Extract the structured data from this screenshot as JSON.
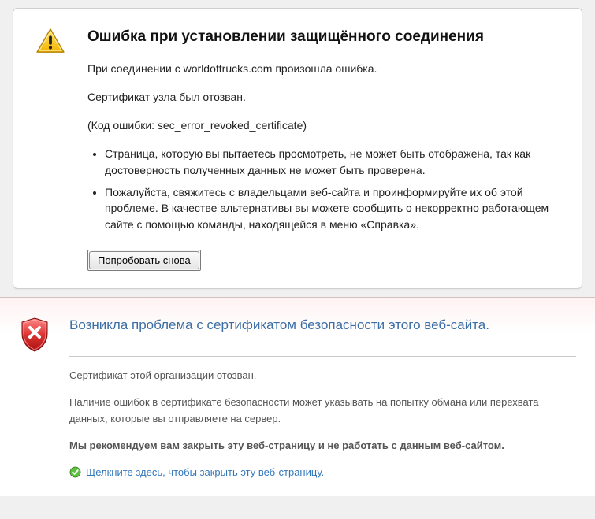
{
  "firefox": {
    "title": "Ошибка при установлении защищённого соединения",
    "p1": "При соединении с worldoftrucks.com произошла ошибка.",
    "p2": "Сертификат узла был отозван.",
    "p3": "(Код ошибки: sec_error_revoked_certificate)",
    "bullet1": "Страница, которую вы пытаетесь просмотреть, не может быть отображена, так как достоверность полученных данных не может быть проверена.",
    "bullet2": "Пожалуйста, свяжитесь с владельцами веб-сайта и проинформируйте их об этой проблеме. В качестве альтернативы вы можете сообщить о некорректно работающем сайте с помощью команды, находящейся в меню «Справка».",
    "retry_label": "Попробовать снова"
  },
  "ie": {
    "title": "Возникла проблема с сертификатом безопасности этого веб-сайта.",
    "revoked": "Сертификат этой организации отозван.",
    "warning": "Наличие ошибок в сертификате безопасности может указывать на попытку обмана или перехвата данных, которые вы отправляете на сервер.",
    "recommend": "Мы рекомендуем вам закрыть эту веб-страницу и не работать с данным веб-сайтом.",
    "close_label": "Щелкните здесь, чтобы закрыть эту веб-страницу."
  }
}
